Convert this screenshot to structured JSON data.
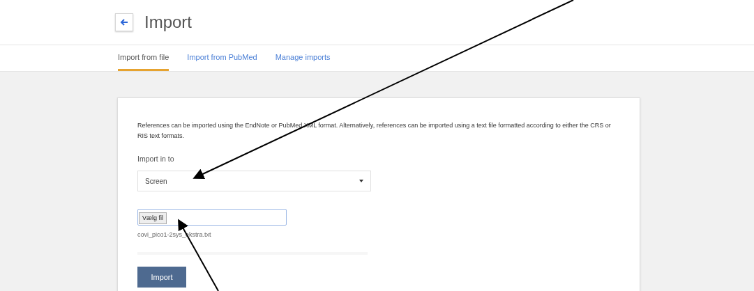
{
  "header": {
    "title": "Import"
  },
  "tabs": [
    {
      "label": "Import from file",
      "selected": true
    },
    {
      "label": "Import from PubMed",
      "selected": false
    },
    {
      "label": "Manage imports",
      "selected": false
    }
  ],
  "card": {
    "description": "References can be imported using the EndNote or PubMed XML format. Alternatively, references can be imported using a text file formatted according to either the CRS or RIS text formats.",
    "import_into": {
      "label": "Import in to",
      "value": "Screen"
    },
    "file": {
      "button": "Vælg fil",
      "filename": "covi_pico1-2sys_ekstra.txt"
    },
    "submit": "Import"
  }
}
